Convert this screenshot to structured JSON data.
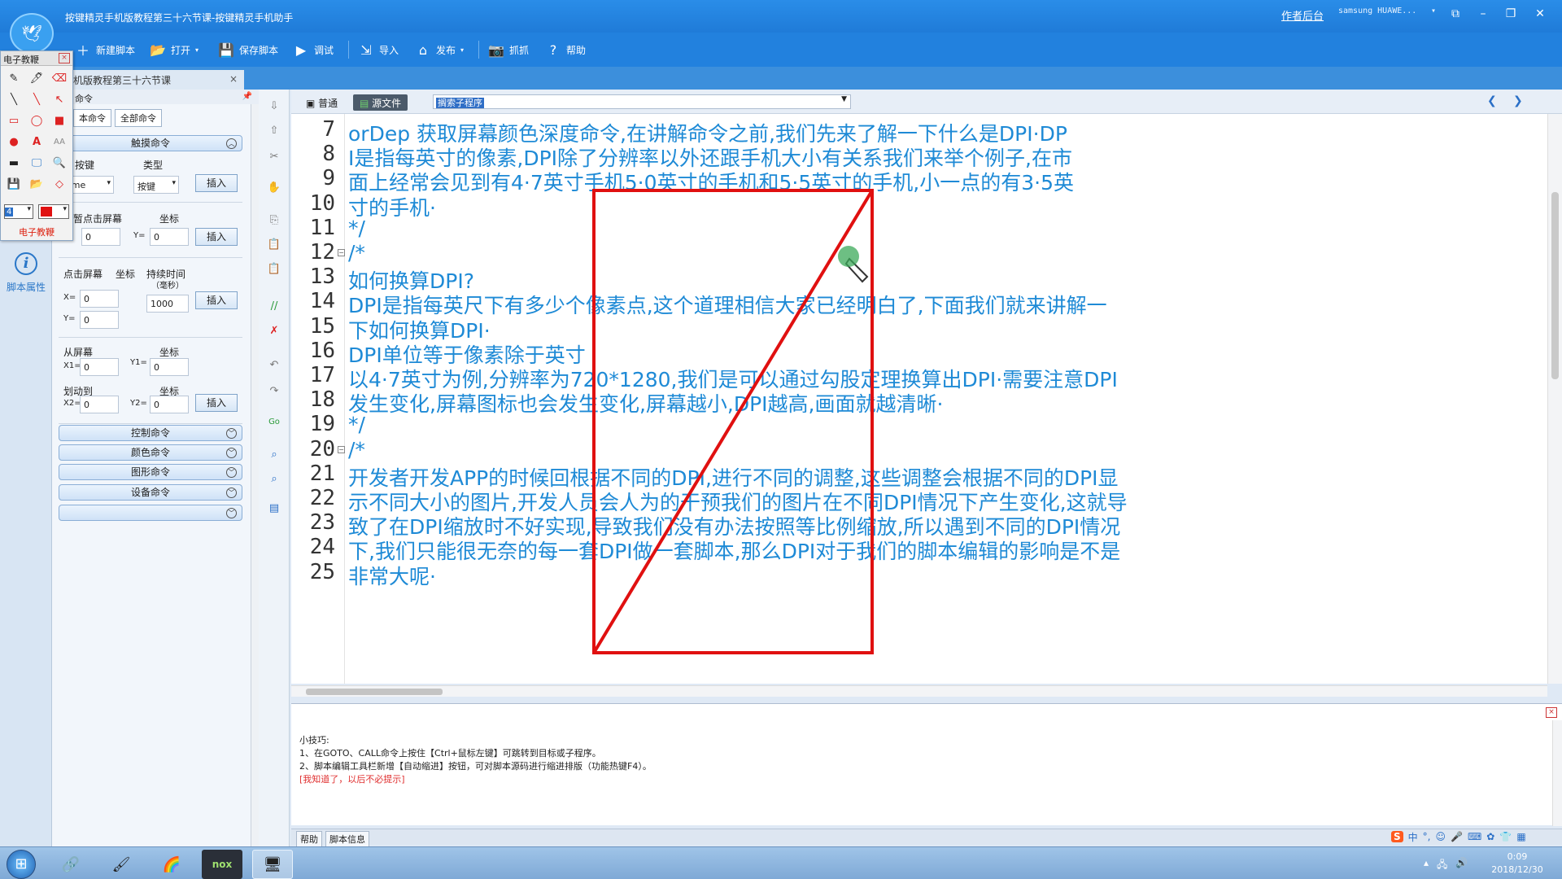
{
  "window": {
    "title": "按键精灵手机版教程第三十六节课-按键精灵手机助手",
    "backend_link": "作者后台",
    "device": "samsung HUAWE...",
    "logo_icon": "sprite-logo-icon"
  },
  "toolbar": {
    "new_script": "新建脚本",
    "open": "打开",
    "save_script": "保存脚本",
    "debug": "调试",
    "import": "导入",
    "publish": "发布",
    "capture": "抓抓",
    "help": "帮助"
  },
  "doc_tab": {
    "label": "机版教程第三十六节课",
    "close": "×"
  },
  "sidebar": {
    "script_props": "脚本属性"
  },
  "toolbox": {
    "title": "电子教鞭",
    "close": "×",
    "color_value": "4",
    "label": "电子教鞭",
    "text_tool": "A",
    "text_size_tool": "AA"
  },
  "cmdpanel": {
    "header": "命令",
    "tab_basic": "本命令",
    "tab_all": "全部命令",
    "section_touch": "触摸命令",
    "key_label": "按键",
    "type_label": "类型",
    "key_value": "ome",
    "type_value": "按键",
    "insert": "插入",
    "tap_label": "暂点击屏幕",
    "coord_label": "坐标",
    "y_label": "Y=",
    "x_label": "X=",
    "zero": "0",
    "press_label": "点击屏幕",
    "duration_label": "持续时间",
    "duration_unit": "（毫秒）",
    "duration_value": "1000",
    "swipe_from": "从屏幕",
    "swipe_to": "划动到",
    "x1_label": "X1=",
    "y1_label": "Y1=",
    "x2_label": "X2=",
    "y2_label": "Y2=",
    "section_control": "控制命令",
    "section_color": "颜色命令",
    "section_graphic": "图形命令",
    "section_device": "设备命令"
  },
  "editor": {
    "mode_normal": "普通",
    "mode_source": "源文件",
    "sub_select": "搁索子程序",
    "nav_prev": "❮",
    "nav_next": "❯",
    "lines": [
      {
        "n": "7",
        "text": "orDep 获取屏幕颜色深度命令,在讲解命令之前,我们先来了解一下什么是DPI·DP"
      },
      {
        "n": "8",
        "text": "I是指每英寸的像素,DPI除了分辨率以外还跟手机大小有关系我们来举个例子,在市"
      },
      {
        "n": "9",
        "text": "面上经常会见到有4·7英寸手机5·0英寸的手机和5·5英寸的手机,小一点的有3·5英"
      },
      {
        "n": "10",
        "text": "寸的手机·"
      },
      {
        "n": "11",
        "text": "*/"
      },
      {
        "n": "12",
        "text": "/*"
      },
      {
        "n": "13",
        "text": "如何换算DPI?"
      },
      {
        "n": "14",
        "text": "DPI是指每英尺下有多少个像素点,这个道理相信大家已经明白了,下面我们就来讲解一"
      },
      {
        "n": "15",
        "text": "下如何换算DPI·"
      },
      {
        "n": "16",
        "text": "DPI单位等于像素除于英寸"
      },
      {
        "n": "17",
        "text": "以4·7英寸为例,分辨率为720*1280,我们是可以通过勾股定理换算出DPI·需要注意DPI"
      },
      {
        "n": "18",
        "text": "发生变化,屏幕图标也会发生变化,屏幕越小,DPI越高,画面就越清晰·"
      },
      {
        "n": "19",
        "text": "*/"
      },
      {
        "n": "20",
        "text": "/*"
      },
      {
        "n": "21",
        "text": "开发者开发APP的时候回根据不同的DPI,进行不同的调整,这些调整会根据不同的DPI显"
      },
      {
        "n": "22",
        "text": "示不同大小的图片,开发人员会人为的干预我们的图片在不同DPI情况下产生变化,这就导"
      },
      {
        "n": "23",
        "text": "致了在DPI缩放时不好实现,导致我们没有办法按照等比例缩放,所以遇到不同的DPI情况"
      },
      {
        "n": "24",
        "text": "下,我们只能很无奈的每一套DPI做一套脚本,那么DPI对于我们的脚本编辑的影响是不是"
      },
      {
        "n": "25",
        "text": "非常大呢·"
      }
    ]
  },
  "tips": {
    "title": "小技巧:",
    "tip1": "1、在GOTO、CALL命令上按住【Ctrl+鼠标左键】可跳转到目标或子程序。",
    "tip2": "2、脚本编辑工具栏新增【自动缩进】按钮，可对脚本源码进行缩进排版（功能热键F4）。",
    "dismiss": "[我知道了，以后不必提示]"
  },
  "bottom_tabs": {
    "help": "帮助",
    "script_info": "脚本信息"
  },
  "ime": {
    "logo": "S",
    "lang": "中"
  },
  "taskbar": {
    "time": "0:09",
    "date": "2018/12/30"
  },
  "colors": {
    "titlebar": "#1f7bd8",
    "code_text": "#1e8ad6",
    "annotation_red": "#e01010"
  }
}
